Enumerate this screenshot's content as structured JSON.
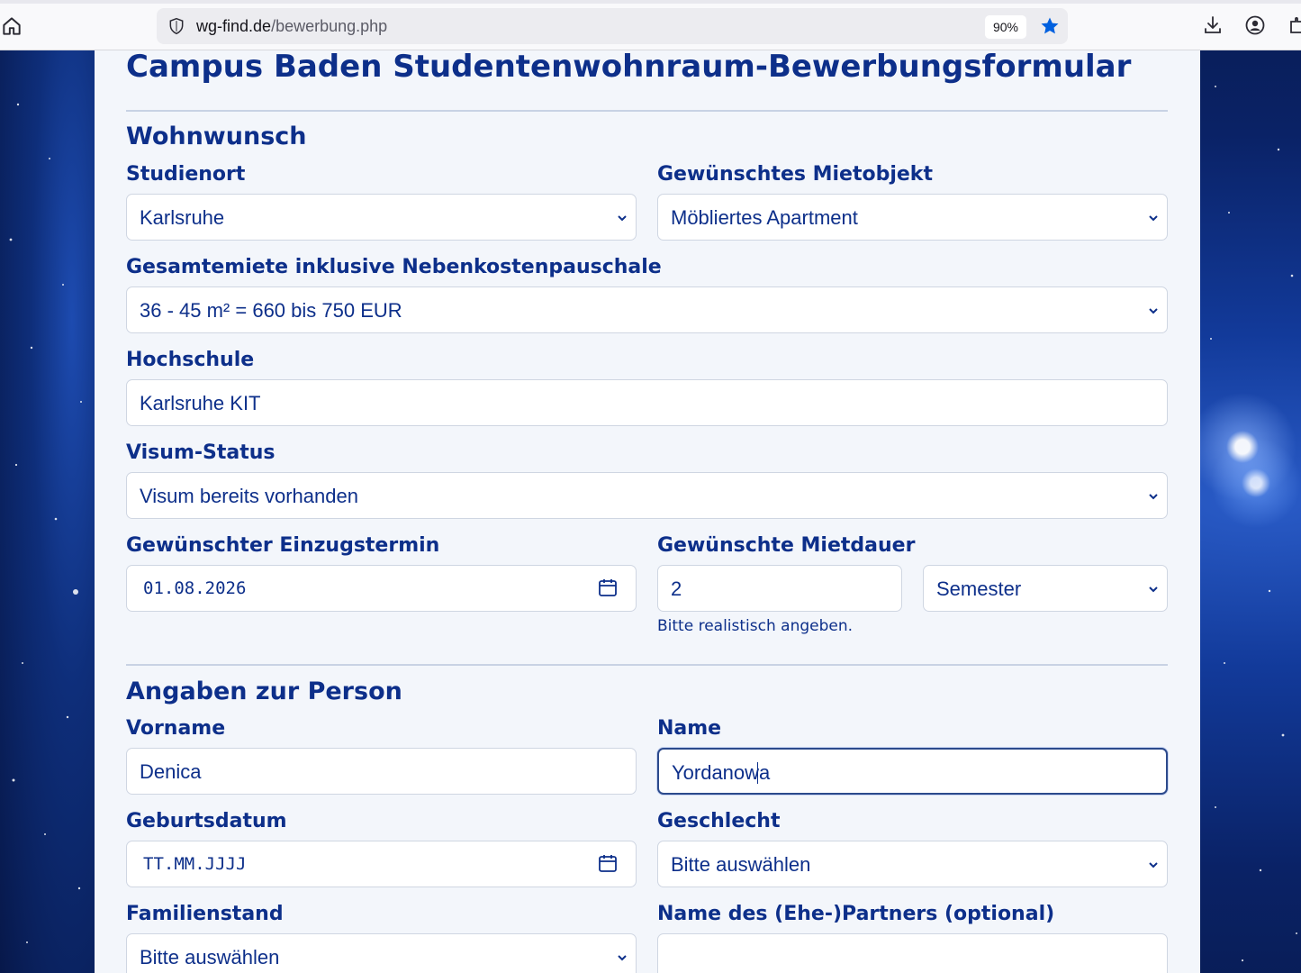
{
  "browser": {
    "url_host": "wg-find.de",
    "url_path": "/bewerbung.php",
    "zoom": "90%"
  },
  "form": {
    "title": "Campus Baden Studentenwohnraum-Bewerbungsformular",
    "section_wohnwunsch": "Wohnwunsch",
    "studienort_label": "Studienort",
    "studienort_value": "Karlsruhe",
    "mietobjekt_label": "Gewünschtes Mietobjekt",
    "mietobjekt_value": "Möbliertes Apartment",
    "miete_label": "Gesamtemiete inklusive Nebenkostenpauschale",
    "miete_value": "36 - 45 m² = 660 bis 750 EUR",
    "hochschule_label": "Hochschule",
    "hochschule_value": "Karlsruhe KIT",
    "visum_label": "Visum-Status",
    "visum_value": "Visum bereits vorhanden",
    "einzug_label": "Gewünschter Einzugstermin",
    "einzug_value": "01.08.2026",
    "mietdauer_label": "Gewünschte Mietdauer",
    "mietdauer_value": "2",
    "mietdauer_unit": "Semester",
    "mietdauer_hint": "Bitte realistisch angeben.",
    "section_person": "Angaben zur Person",
    "vorname_label": "Vorname",
    "vorname_value": "Denica",
    "name_label": "Name",
    "name_value": "Yordanowa",
    "geburtsdatum_label": "Geburtsdatum",
    "geburtsdatum_placeholder": "TT.MM.JJJJ",
    "geschlecht_label": "Geschlecht",
    "geschlecht_value": "Bitte auswählen",
    "familienstand_label": "Familienstand",
    "familienstand_value": "Bitte auswählen",
    "partner_label": "Name des (Ehe-)Partners (optional)",
    "partner_value": ""
  },
  "colors": {
    "primary": "#0d2f8a",
    "panel_bg": "#f3f6fb",
    "star_icon": "#0060df"
  }
}
